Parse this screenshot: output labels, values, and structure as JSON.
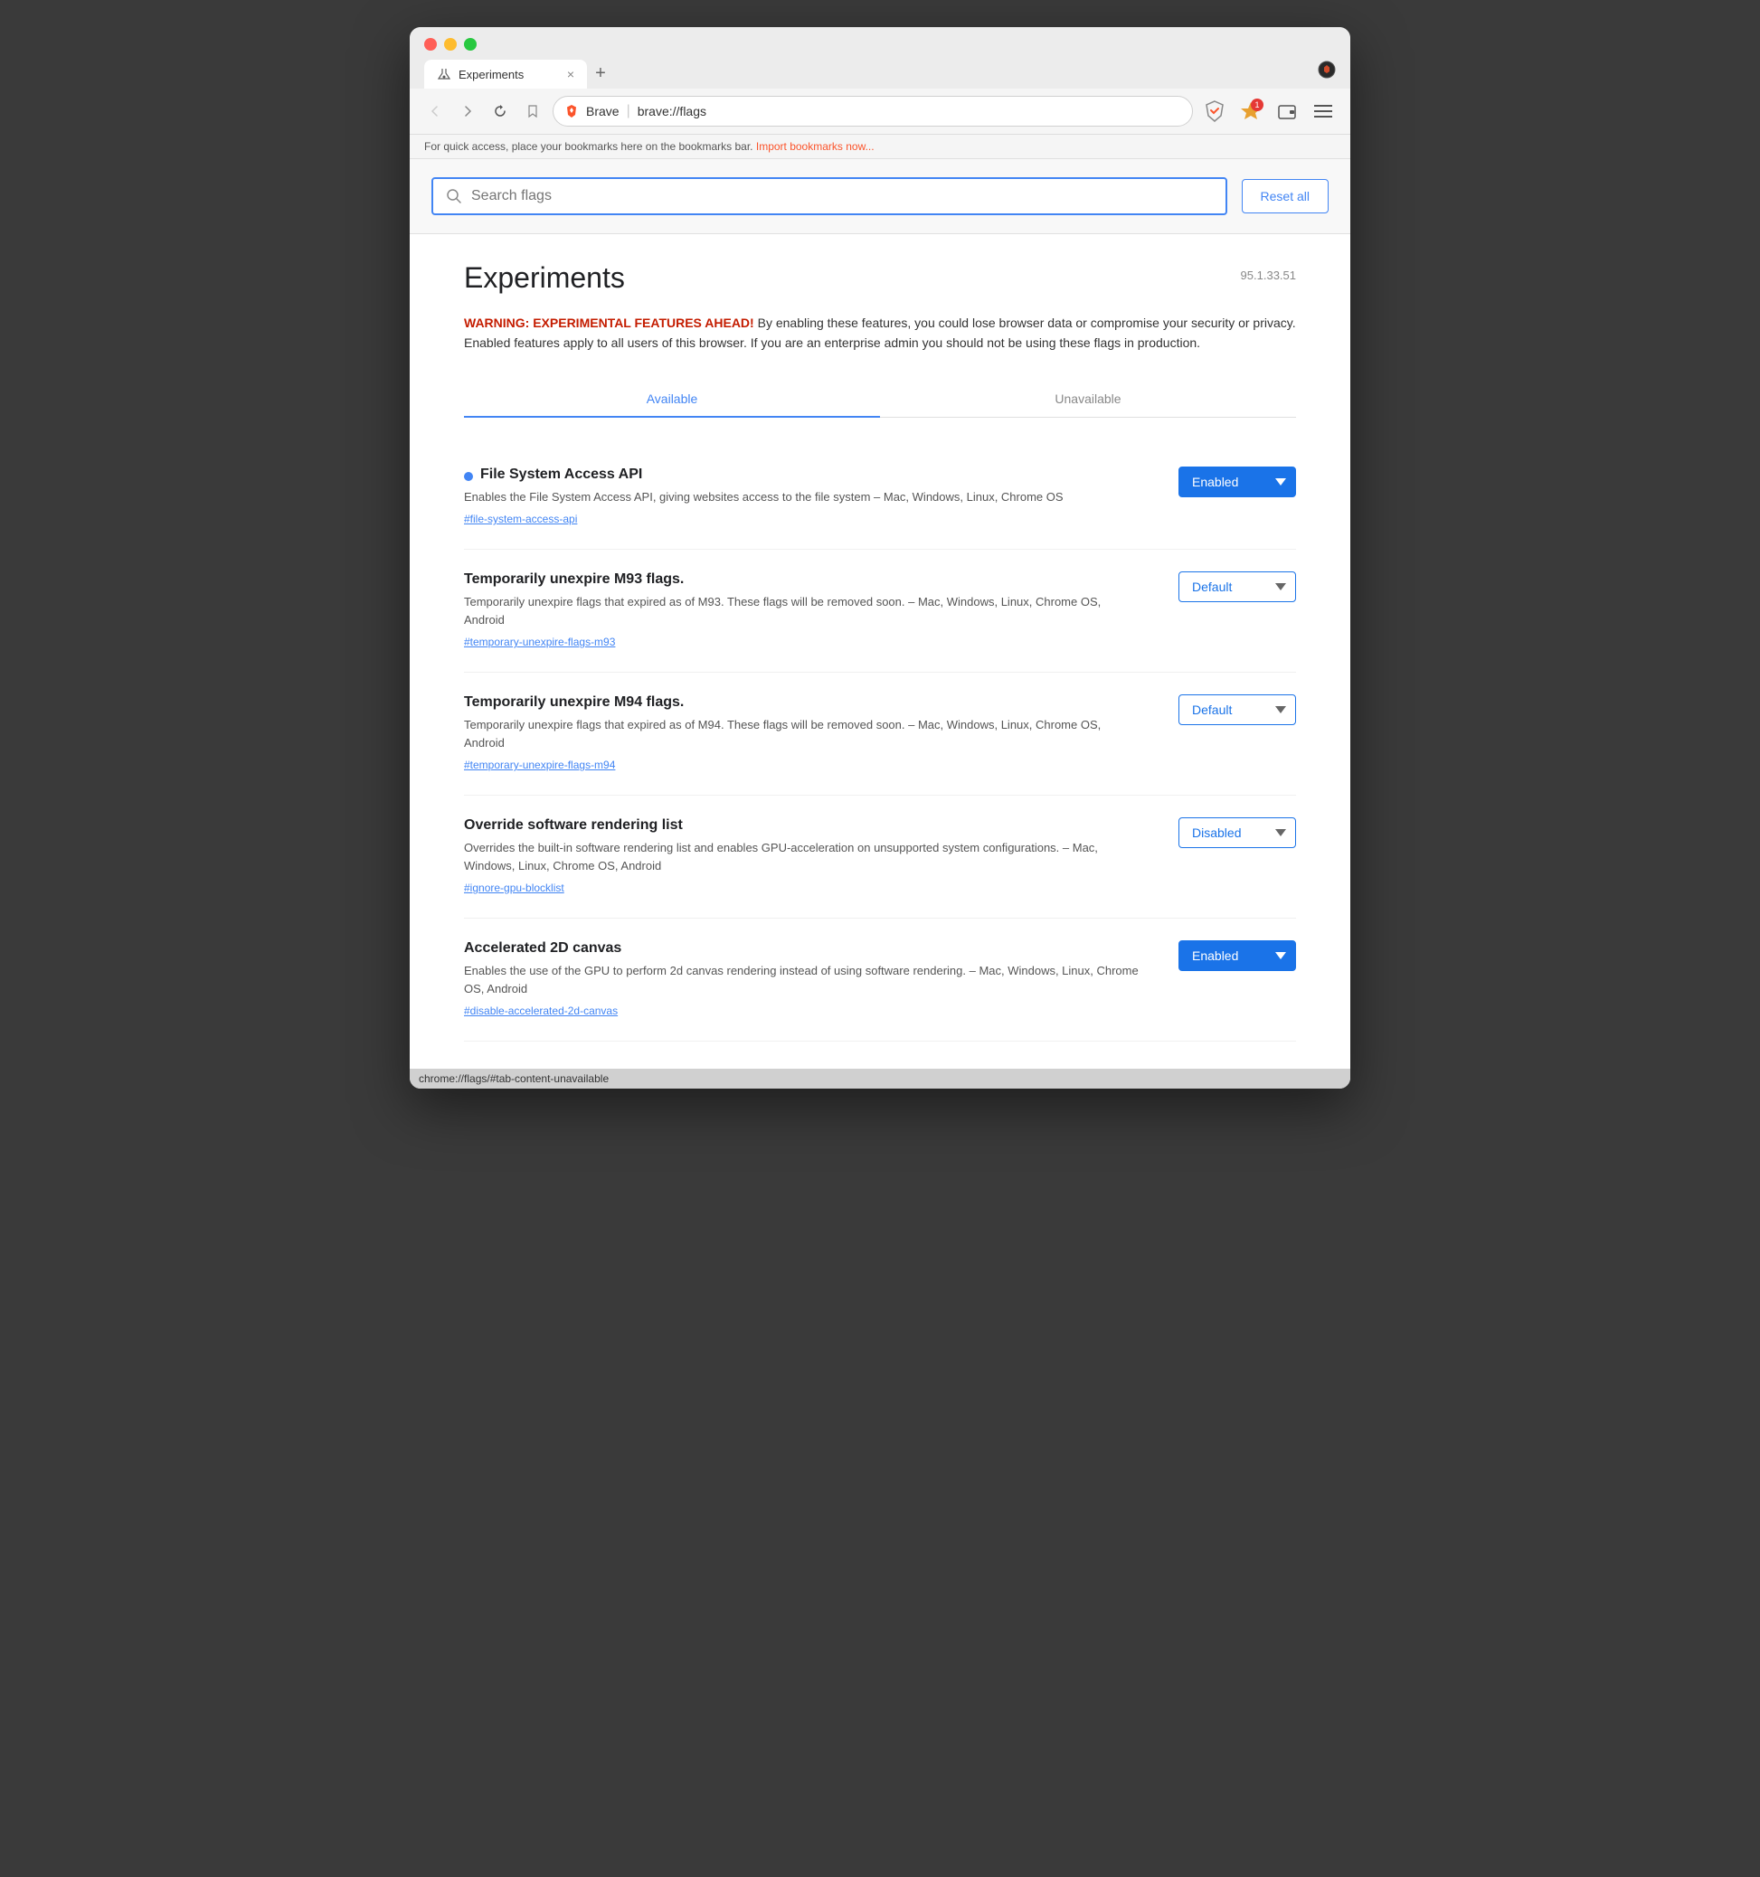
{
  "browser": {
    "tab_title": "Experiments",
    "tab_close": "×",
    "tab_new": "+",
    "address_bar": {
      "brand": "Brave",
      "url": "brave://flags",
      "separator": "|"
    },
    "nav": {
      "back": "‹",
      "forward": "›",
      "reload": "↻",
      "bookmark": "🔖"
    },
    "rewards_badge": "1",
    "bookmarks_bar_text": "For quick access, place your bookmarks here on the bookmarks bar.",
    "bookmarks_bar_link": "Import bookmarks now..."
  },
  "search": {
    "placeholder": "Search flags",
    "reset_btn": "Reset all"
  },
  "page": {
    "title": "Experiments",
    "version": "95.1.33.51",
    "warning_label": "WARNING: EXPERIMENTAL FEATURES AHEAD!",
    "warning_text": " By enabling these features, you could lose browser data or compromise your security or privacy. Enabled features apply to all users of this browser. If you are an enterprise admin you should not be using these flags in production."
  },
  "tabs": [
    {
      "id": "available",
      "label": "Available",
      "active": true
    },
    {
      "id": "unavailable",
      "label": "Unavailable",
      "active": false
    }
  ],
  "flags": [
    {
      "id": "file-system-access-api",
      "title": "File System Access API",
      "has_dot": true,
      "description": "Enables the File System Access API, giving websites access to the file system – Mac, Windows, Linux, Chrome OS",
      "link": "#file-system-access-api",
      "status": "enabled",
      "select_value": "Enabled"
    },
    {
      "id": "temporarily-unexpire-m93-flags",
      "title": "Temporarily unexpire M93 flags.",
      "has_dot": false,
      "description": "Temporarily unexpire flags that expired as of M93. These flags will be removed soon. – Mac, Windows, Linux, Chrome OS, Android",
      "link": "#temporary-unexpire-flags-m93",
      "status": "default",
      "select_value": "Default"
    },
    {
      "id": "temporarily-unexpire-m94-flags",
      "title": "Temporarily unexpire M94 flags.",
      "has_dot": false,
      "description": "Temporarily unexpire flags that expired as of M94. These flags will be removed soon. – Mac, Windows, Linux, Chrome OS, Android",
      "link": "#temporary-unexpire-flags-m94",
      "status": "default",
      "select_value": "Default"
    },
    {
      "id": "override-software-rendering-list",
      "title": "Override software rendering list",
      "has_dot": false,
      "description": "Overrides the built-in software rendering list and enables GPU-acceleration on unsupported system configurations. – Mac, Windows, Linux, Chrome OS, Android",
      "link": "#ignore-gpu-blocklist",
      "status": "disabled",
      "select_value": "Disabled"
    },
    {
      "id": "accelerated-2d-canvas",
      "title": "Accelerated 2D canvas",
      "has_dot": false,
      "description": "Enables the use of the GPU to perform 2d canvas rendering instead of using software rendering. – Mac, Windows, Linux, Chrome OS, Android",
      "link": "#disable-accelerated-2d-canvas",
      "status": "enabled",
      "select_value": "Enabled"
    }
  ],
  "status_bar": {
    "url": "chrome://flags/#tab-content-unavailable"
  },
  "colors": {
    "accent_blue": "#4285f4",
    "warning_red": "#c41c00",
    "enabled_bg": "#1a73e8"
  }
}
